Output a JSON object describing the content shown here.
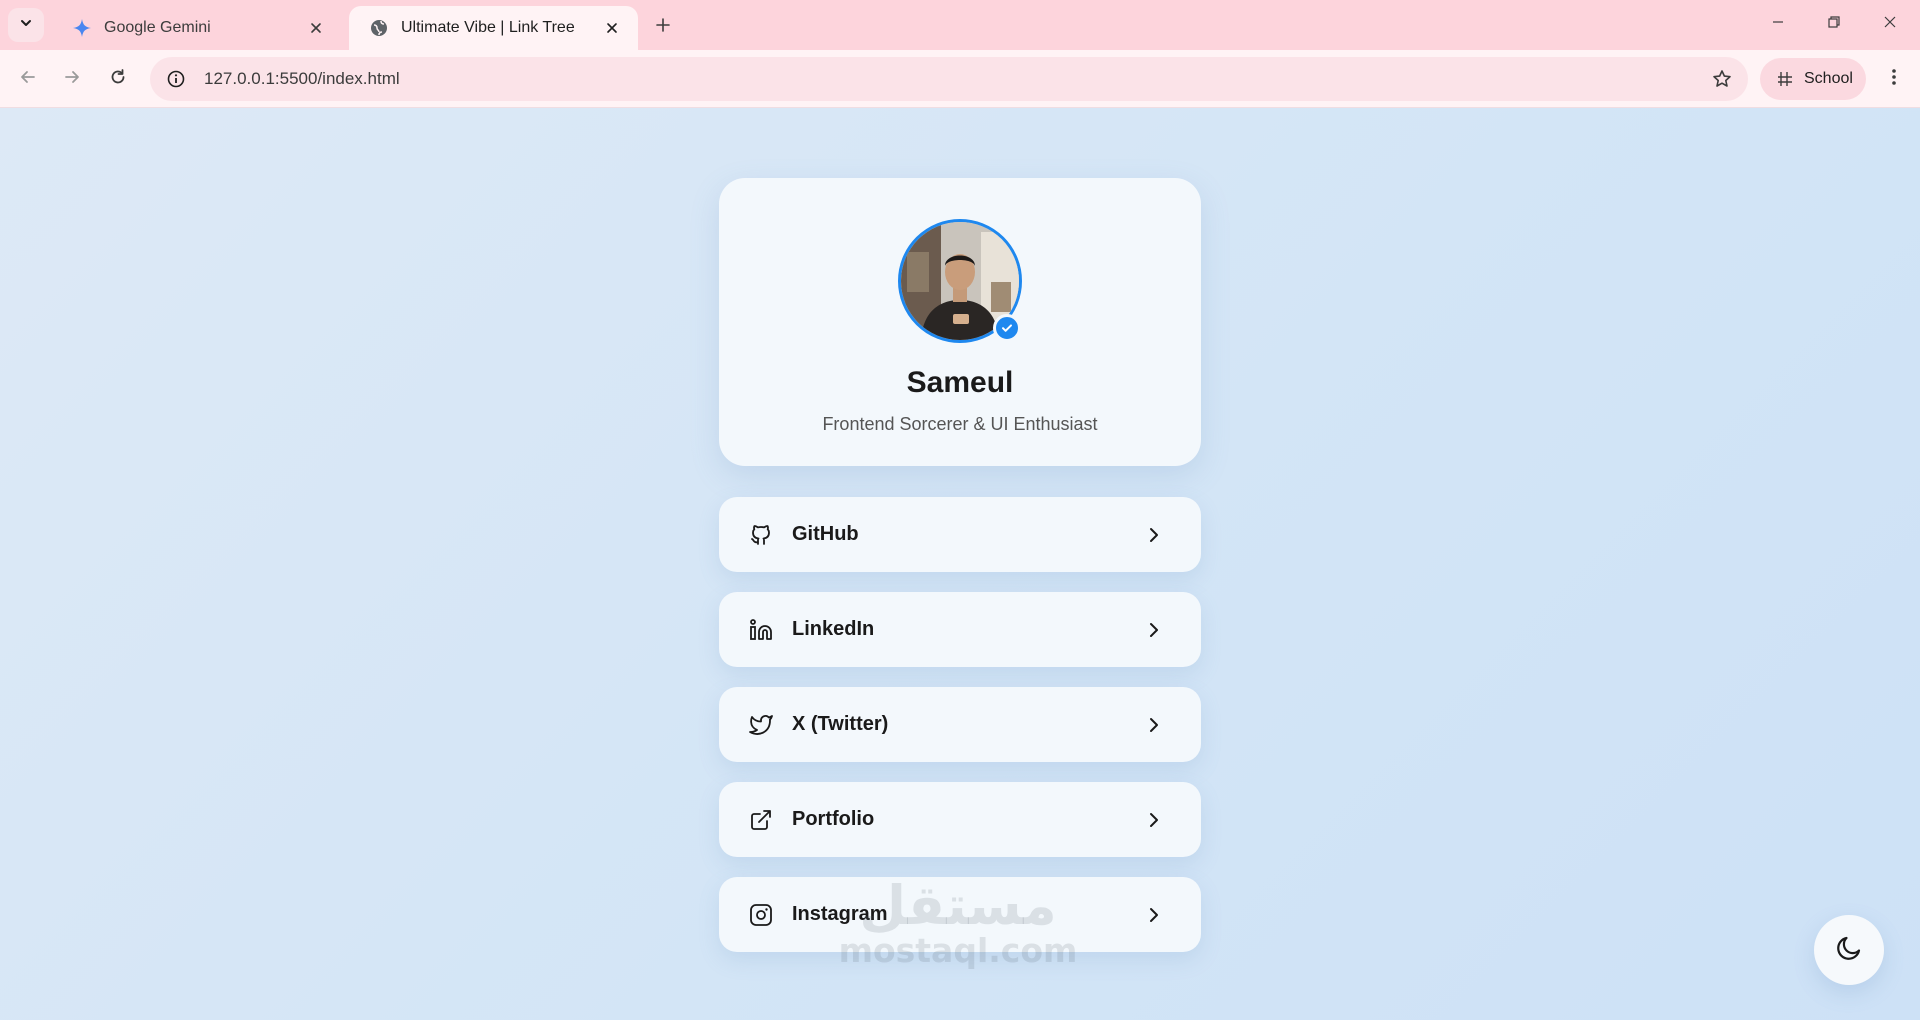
{
  "browser": {
    "tabs": [
      {
        "title": "Google Gemini",
        "favicon": "gemini-icon",
        "active": false
      },
      {
        "title": "Ultimate Vibe | Link Tree",
        "favicon": "globe-icon",
        "active": true
      }
    ],
    "url": "127.0.0.1:5500/index.html",
    "profile_label": "School"
  },
  "profile": {
    "name": "Sameul",
    "tagline": "Frontend Sorcerer & UI Enthusiast",
    "verified": true
  },
  "links": [
    {
      "label": "GitHub",
      "icon": "github-icon"
    },
    {
      "label": "LinkedIn",
      "icon": "linkedin-icon"
    },
    {
      "label": "X (Twitter)",
      "icon": "twitter-icon"
    },
    {
      "label": "Portfolio",
      "icon": "external-link-icon"
    },
    {
      "label": "Instagram",
      "icon": "instagram-icon"
    }
  ],
  "theme_toggle_icon": "moon-icon",
  "watermark": {
    "arabic": "مستقل",
    "latin": "mostaql.com"
  },
  "colors": {
    "accent": "#1e88ef",
    "tabbar": "#fdd4dc",
    "page_bg": "#d9e8f6",
    "card_bg": "#f3f8fc"
  }
}
